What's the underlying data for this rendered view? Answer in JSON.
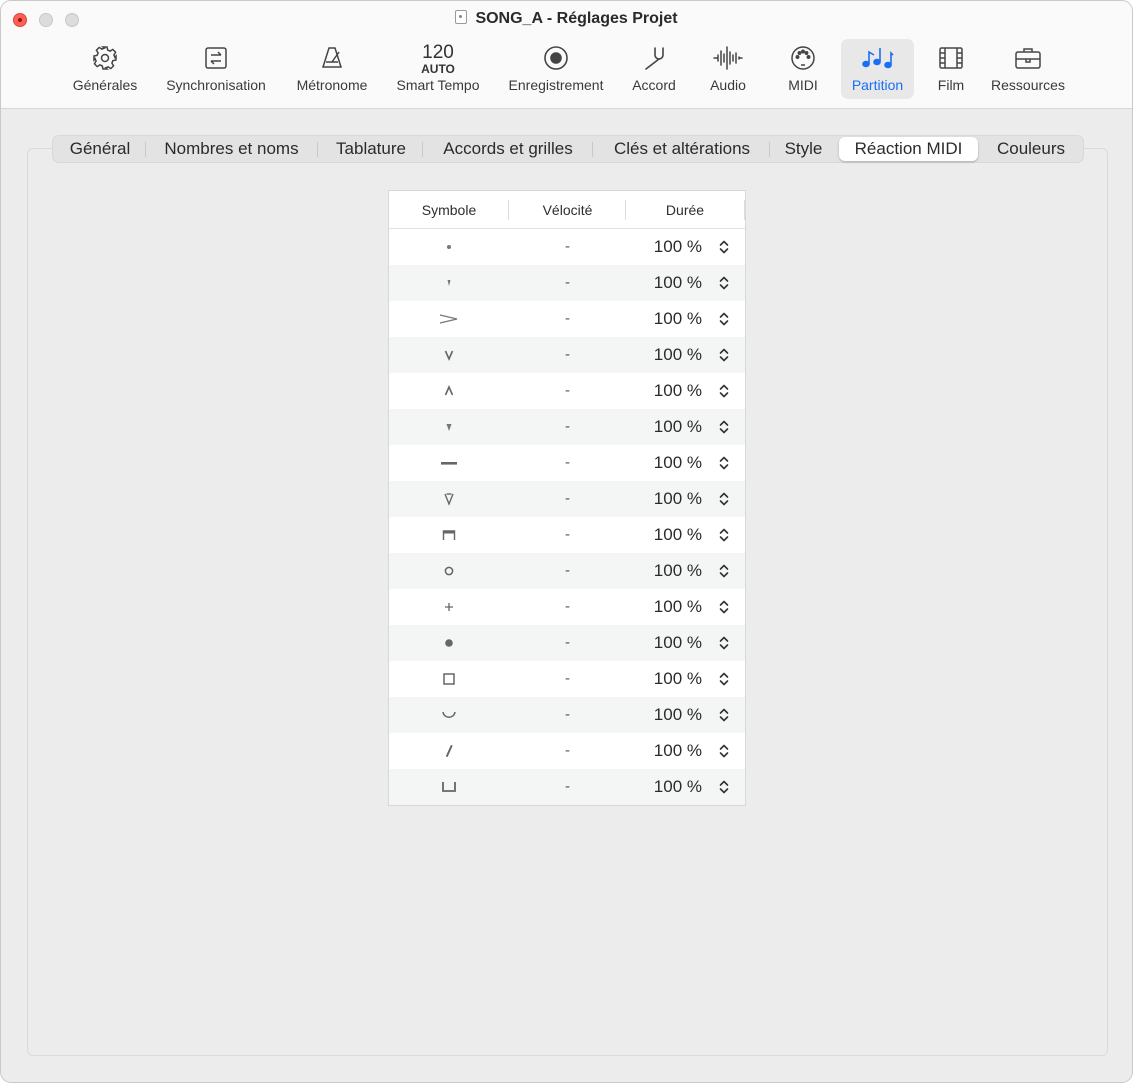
{
  "window": {
    "title": "SONG_A - Réglages Projet"
  },
  "toolbar": {
    "items": [
      {
        "label": "Générales",
        "icon": "gear-icon"
      },
      {
        "label": "Synchronisation",
        "icon": "sync-icon"
      },
      {
        "label": "Métronome",
        "icon": "metronome-icon"
      },
      {
        "label": "Smart Tempo",
        "icon": "tempo-icon",
        "tempo_value": "120",
        "tempo_mode": "AUTO"
      },
      {
        "label": "Enregistrement",
        "icon": "record-icon"
      },
      {
        "label": "Accord",
        "icon": "tuning-fork-icon"
      },
      {
        "label": "Audio",
        "icon": "waveform-icon"
      },
      {
        "label": "MIDI",
        "icon": "midi-port-icon"
      },
      {
        "label": "Partition",
        "icon": "notes-icon",
        "active": true
      },
      {
        "label": "Film",
        "icon": "film-icon"
      },
      {
        "label": "Ressources",
        "icon": "briefcase-icon"
      }
    ],
    "active_color": "#1a6ef5"
  },
  "tabs": [
    {
      "label": "Général"
    },
    {
      "label": "Nombres et noms"
    },
    {
      "label": "Tablature"
    },
    {
      "label": "Accords et grilles"
    },
    {
      "label": "Clés et altérations"
    },
    {
      "label": "Style"
    },
    {
      "label": "Réaction MIDI",
      "selected": true
    },
    {
      "label": "Couleurs"
    }
  ],
  "table": {
    "columns": [
      "Symbole",
      "Vélocité",
      "Durée"
    ],
    "rows": [
      {
        "symbol": "staccato-dot-icon",
        "velocity": "-",
        "duration": "100 %"
      },
      {
        "symbol": "staccatissimo-wedge-icon",
        "velocity": "-",
        "duration": "100 %"
      },
      {
        "symbol": "accent-icon",
        "velocity": "-",
        "duration": "100 %"
      },
      {
        "symbol": "marcato-down-icon",
        "velocity": "-",
        "duration": "100 %"
      },
      {
        "symbol": "marcato-up-icon",
        "velocity": "-",
        "duration": "100 %"
      },
      {
        "symbol": "wedge-icon",
        "velocity": "-",
        "duration": "100 %"
      },
      {
        "symbol": "tenuto-icon",
        "velocity": "-",
        "duration": "100 %"
      },
      {
        "symbol": "marcato-staccato-icon",
        "velocity": "-",
        "duration": "100 %"
      },
      {
        "symbol": "down-bow-icon",
        "velocity": "-",
        "duration": "100 %"
      },
      {
        "symbol": "harmonic-circle-icon",
        "velocity": "-",
        "duration": "100 %"
      },
      {
        "symbol": "stopped-plus-icon",
        "velocity": "-",
        "duration": "100 %"
      },
      {
        "symbol": "filled-dot-icon",
        "velocity": "-",
        "duration": "100 %"
      },
      {
        "symbol": "square-icon",
        "velocity": "-",
        "duration": "100 %"
      },
      {
        "symbol": "curve-icon",
        "velocity": "-",
        "duration": "100 %"
      },
      {
        "symbol": "slash-icon",
        "velocity": "-",
        "duration": "100 %"
      },
      {
        "symbol": "bracket-icon",
        "velocity": "-",
        "duration": "100 %"
      }
    ]
  }
}
